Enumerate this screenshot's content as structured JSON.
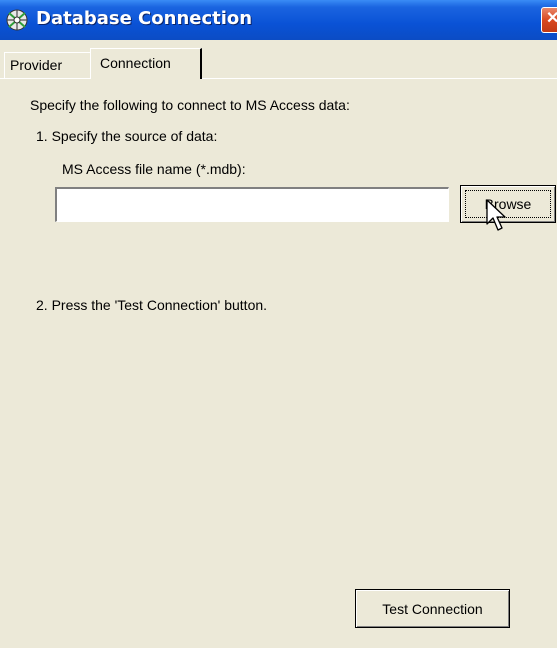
{
  "window": {
    "title": "Database Connection",
    "icon": "database-connection-icon",
    "close_label": "✕"
  },
  "tabs": [
    {
      "label": "Provider",
      "active": false
    },
    {
      "label": "Connection",
      "active": true
    }
  ],
  "connection": {
    "intro": "Specify the following to connect to MS Access data:",
    "step1": "1. Specify the source of data:",
    "file_label": "MS Access file name (*.mdb):",
    "file_value": "",
    "browse_label": "Browse",
    "step2": "2. Press the 'Test Connection' button.",
    "test_label": "Test Connection"
  },
  "colors": {
    "titlebar": "#0b4cc4",
    "window_bg": "#ece9d8",
    "close": "#d9491f"
  }
}
